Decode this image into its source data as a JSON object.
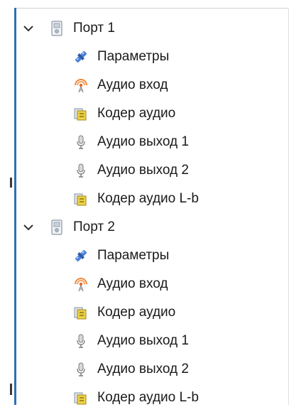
{
  "tree": {
    "ports": [
      {
        "label": "Порт 1",
        "icon": "device-icon",
        "expanded": true,
        "children": [
          {
            "label": "Параметры",
            "icon": "connector-icon"
          },
          {
            "label": "Аудио вход",
            "icon": "broadcast-icon"
          },
          {
            "label": "Кодер аудио",
            "icon": "encoder-icon"
          },
          {
            "label": "Аудио выход 1",
            "icon": "microphone-icon"
          },
          {
            "label": "Аудио выход 2",
            "icon": "microphone-icon"
          },
          {
            "label": "Кодер аудио L-b",
            "icon": "encoder-icon"
          }
        ]
      },
      {
        "label": "Порт 2",
        "icon": "device-icon",
        "expanded": true,
        "children": [
          {
            "label": "Параметры",
            "icon": "connector-icon"
          },
          {
            "label": "Аудио вход",
            "icon": "broadcast-icon"
          },
          {
            "label": "Кодер аудио",
            "icon": "encoder-icon"
          },
          {
            "label": "Аудио выход 1",
            "icon": "microphone-icon"
          },
          {
            "label": "Аудио выход 2",
            "icon": "microphone-icon"
          },
          {
            "label": "Кодер аудио L-b",
            "icon": "encoder-icon"
          }
        ]
      }
    ]
  },
  "colors": {
    "accent_bar": "#2f6fb5",
    "connector": "#3b6fc4",
    "broadcast": "#f08a3c",
    "encoder_yellow": "#e8c832",
    "device": "#9aa4b0"
  }
}
